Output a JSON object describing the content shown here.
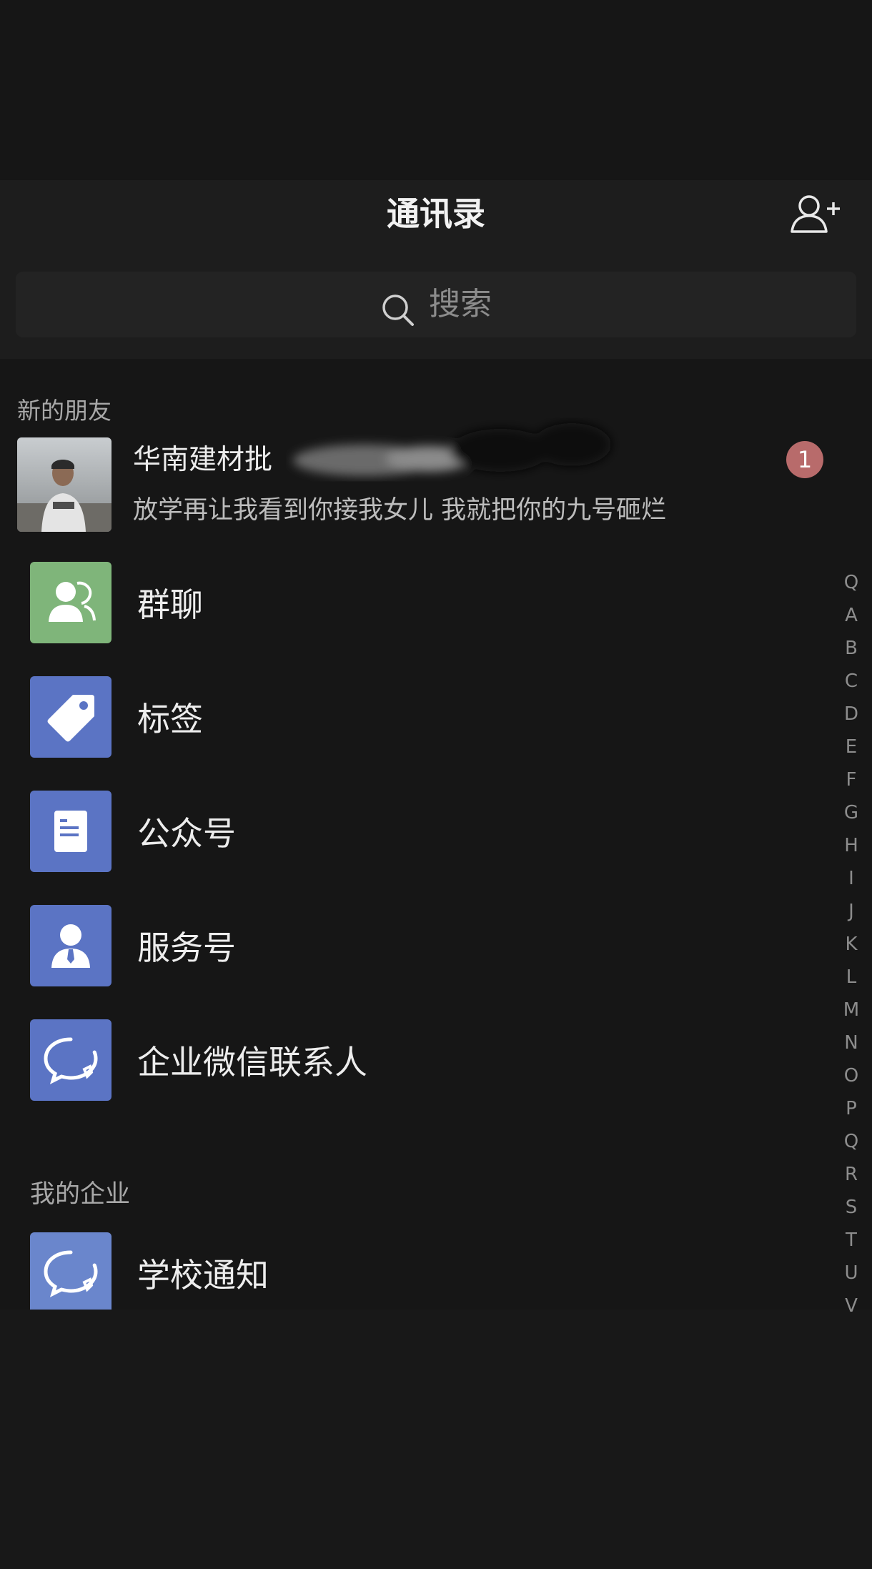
{
  "header": {
    "title": "通讯录",
    "add_icon": "add-contact-icon"
  },
  "search": {
    "placeholder": "搜索",
    "icon": "search-icon"
  },
  "new_friends": {
    "section_label": "新的朋友",
    "name": "华南建材批",
    "message": "放学再让我看到你接我女儿 我就把你的九号砸烂",
    "badge": "1"
  },
  "menu": [
    {
      "label": "群聊",
      "icon": "group-chat-icon",
      "color": "#7fb57a"
    },
    {
      "label": "标签",
      "icon": "tag-icon",
      "color": "#5b74c4"
    },
    {
      "label": "公众号",
      "icon": "official-account-icon",
      "color": "#5b74c4"
    },
    {
      "label": "服务号",
      "icon": "service-account-icon",
      "color": "#5b74c4"
    },
    {
      "label": "企业微信联系人",
      "icon": "wecom-icon",
      "color": "#5b74c4"
    }
  ],
  "enterprise": {
    "section_label": "我的企业",
    "items": [
      {
        "label": "学校通知",
        "icon": "wecom-icon",
        "color": "#6a86cc"
      }
    ]
  },
  "index": [
    "Q",
    "A",
    "B",
    "C",
    "D",
    "E",
    "F",
    "G",
    "H",
    "I",
    "J",
    "K",
    "L",
    "M",
    "N",
    "O",
    "P",
    "Q",
    "R",
    "S",
    "T",
    "U",
    "V"
  ]
}
